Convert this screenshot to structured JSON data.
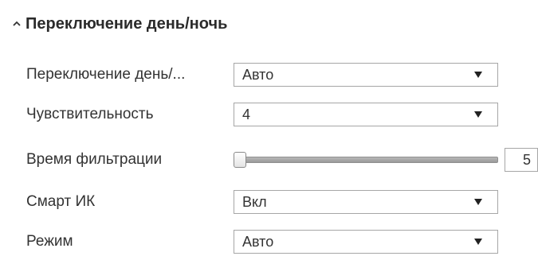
{
  "section": {
    "title": "Переключение день/ночь",
    "expanded": true
  },
  "rows": [
    {
      "label": "Переключение день/...",
      "type": "select",
      "value": "Авто"
    },
    {
      "label": "Чувствительность",
      "type": "select",
      "value": "4"
    },
    {
      "label": "Время фильтрации",
      "type": "slider",
      "value": "5",
      "level": 0
    },
    {
      "label": "Смарт ИК",
      "type": "select",
      "value": "Вкл"
    },
    {
      "label": "Режим",
      "type": "select",
      "value": "Авто"
    }
  ],
  "icons": {
    "section_toggle": "chevron-up-icon",
    "dropdown": "triangle-down-icon"
  }
}
